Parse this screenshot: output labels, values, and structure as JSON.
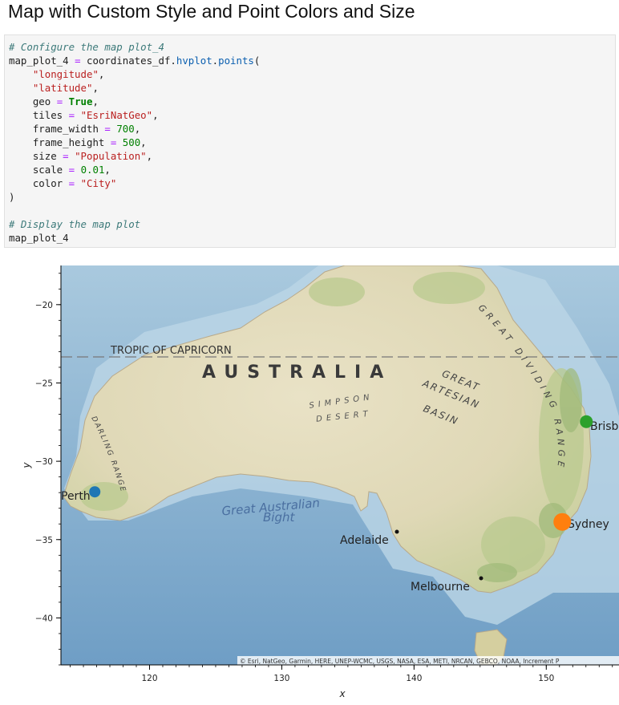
{
  "title": "Map with Custom Style and Point Colors and Size",
  "code": {
    "comment1": "# Configure the map plot_4",
    "line1_a": "map_plot_4 ",
    "line1_op": "=",
    "line1_b": " coordinates_df.",
    "line1_fn1": "hvplot",
    "line1_dot": ".",
    "line1_fn2": "points",
    "line1_paren": "(",
    "arg_longitude": "\"longitude\"",
    "arg_latitude": "\"latitude\"",
    "comma": ",",
    "geo_key": "geo",
    "geo_val": "True",
    "tiles_key": "tiles",
    "tiles_val": "\"EsriNatGeo\"",
    "fw_key": "frame_width",
    "fw_val": "700",
    "fh_key": "frame_height",
    "fh_val": "500",
    "size_key": "size",
    "size_val": "\"Population\"",
    "scale_key": "scale",
    "scale_val": "0.01",
    "color_key": "color",
    "color_val": "\"City\"",
    "eq": "=",
    "close": ")",
    "comment2": "# Display the map plot",
    "last": "map_plot_4"
  },
  "map": {
    "labels": {
      "tropic": "TROPIC OF CAPRICORN",
      "australia": "AUSTRALIA",
      "simpson": "SIMPSON",
      "desert": "DESERT",
      "great": "GREAT",
      "artesian": "ARTESIAN",
      "basin": "BASIN",
      "great_dividing": "GREAT DIVIDING RANGE",
      "darling": "DARLING RANGE",
      "bight1": "Great Australian",
      "bight2": "Bight",
      "perth": "Perth",
      "adelaide": "Adelaide",
      "melbourne": "Melbourne",
      "sydney": "Sydney",
      "brisbane": "Brisb"
    },
    "attribution": "© Esri, NatGeo, Garmin, HERE, UNEP-WCMC, USGS, NASA, ESA, METI, NRCAN, GEBCO, NOAA, Increment P"
  },
  "chart_data": {
    "type": "scatter",
    "xlabel": "x",
    "ylabel": "y",
    "xlim": [
      113.3,
      155.5
    ],
    "ylim": [
      -43.0,
      -17.5
    ],
    "x_ticks": [
      120,
      130,
      140,
      150
    ],
    "y_ticks": [
      -20,
      -25,
      -30,
      -35,
      -40
    ],
    "points": [
      {
        "city": "Perth",
        "lon": 115.86,
        "lat": -31.95,
        "color": "#1f77b4",
        "r": 7
      },
      {
        "city": "Sydney",
        "lon": 151.21,
        "lat": -33.87,
        "color": "#ff7f0e",
        "r": 11
      },
      {
        "city": "Brisbane",
        "lon": 153.03,
        "lat": -27.47,
        "color": "#2ca02c",
        "r": 8
      }
    ],
    "reference_cities": [
      {
        "city": "Adelaide",
        "lon": 138.6,
        "lat": -34.93
      },
      {
        "city": "Melbourne",
        "lon": 144.96,
        "lat": -37.81
      }
    ]
  }
}
